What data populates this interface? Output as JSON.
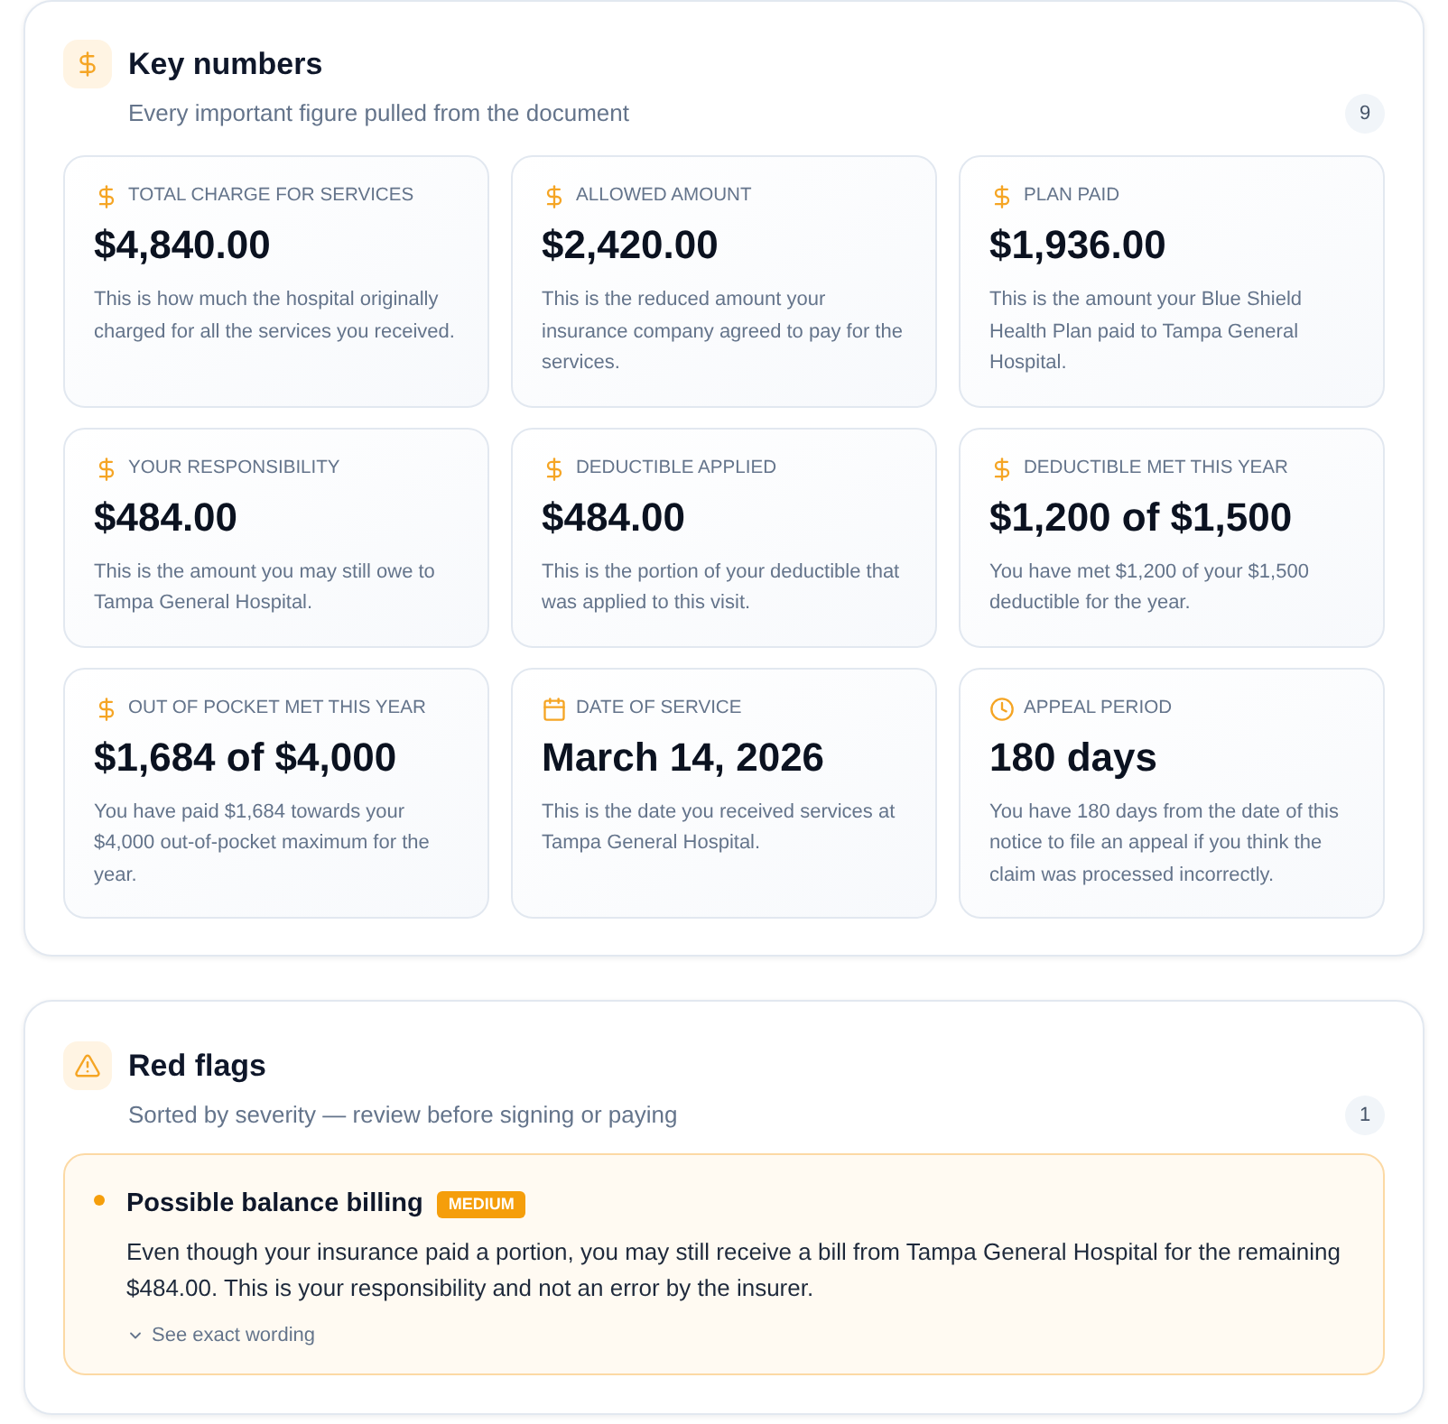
{
  "key_numbers": {
    "title": "Key numbers",
    "subtitle": "Every important figure pulled from the document",
    "count": "9",
    "items": [
      {
        "kind": "money",
        "label": "TOTAL CHARGE FOR SERVICES",
        "value": "$4,840.00",
        "description": "This is how much the hospital originally charged for all the services you received."
      },
      {
        "kind": "money",
        "label": "ALLOWED AMOUNT",
        "value": "$2,420.00",
        "description": "This is the reduced amount your insurance company agreed to pay for the services."
      },
      {
        "kind": "money",
        "label": "PLAN PAID",
        "value": "$1,936.00",
        "description": "This is the amount your Blue Shield Health Plan paid to Tampa General Hospital."
      },
      {
        "kind": "money",
        "label": "YOUR RESPONSIBILITY",
        "value": "$484.00",
        "description": "This is the amount you may still owe to Tampa General Hospital."
      },
      {
        "kind": "money",
        "label": "DEDUCTIBLE APPLIED",
        "value": "$484.00",
        "description": "This is the portion of your deductible that was applied to this visit."
      },
      {
        "kind": "money",
        "label": "DEDUCTIBLE MET THIS YEAR",
        "value": "$1,200 of $1,500",
        "description": "You have met $1,200 of your $1,500 deductible for the year."
      },
      {
        "kind": "money",
        "label": "OUT OF POCKET MET THIS YEAR",
        "value": "$1,684 of $4,000",
        "description": "You have paid $1,684 towards your $4,000 out-of-pocket maximum for the year."
      },
      {
        "kind": "date",
        "label": "DATE OF SERVICE",
        "value": "March 14, 2026",
        "description": "This is the date you received services at Tampa General Hospital."
      },
      {
        "kind": "duration",
        "label": "APPEAL PERIOD",
        "value": "180 days",
        "description": "You have 180 days from the date of this notice to file an appeal if you think the claim was processed incorrectly."
      }
    ]
  },
  "red_flags": {
    "title": "Red flags",
    "subtitle": "Sorted by severity — review before signing or paying",
    "count": "1",
    "items": [
      {
        "title": "Possible balance billing",
        "severity": "MEDIUM",
        "color": "#f59e0b",
        "description": "Even though your insurance paid a portion, you may still receive a bill from Tampa General Hospital for the remaining $484.00. This is your responsibility and not an error by the insurer.",
        "toggle": "See exact wording",
        "expanded": false
      }
    ]
  }
}
